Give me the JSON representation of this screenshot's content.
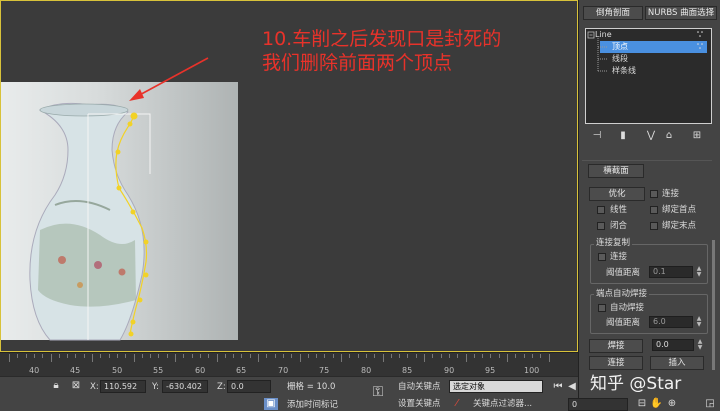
{
  "annotation": {
    "line1": "10.车削之后发现口是封死的",
    "line2": "我们删除前面两个顶点"
  },
  "panel": {
    "lathe_button": "倒角剖面",
    "nurbs_button": "NURBS 曲面选择",
    "stack": {
      "root": "Line",
      "items": [
        "顶点",
        "线段",
        "样条线"
      ]
    },
    "rollout_title": "横截面",
    "optimize_button": "优化",
    "connect_label": "连接",
    "linear_label": "线性",
    "bind_first_label": "绑定首点",
    "closed_label": "闭合",
    "bind_last_label": "绑定末点",
    "connect_copy_group": "连接复制",
    "connect_check_label": "连接",
    "threshold_label": "阈值距离",
    "threshold_value": "0.1",
    "endpoint_weld_group": "端点自动焊接",
    "auto_weld_label": "自动焊接",
    "threshold2_label": "阈值距离",
    "threshold2_value": "6.0",
    "weld_button": "焊接",
    "weld_value": "0.0",
    "connect_button": "连接",
    "insert_button": "插入"
  },
  "timeline": {
    "ticks": [
      "40",
      "45",
      "50",
      "55",
      "60",
      "65",
      "70",
      "75",
      "80",
      "85",
      "90",
      "95",
      "100"
    ]
  },
  "status": {
    "x_label": "X:",
    "x_value": "110.592",
    "y_label": "Y:",
    "y_value": "-630.402",
    "z_label": "Z:",
    "z_value": "0.0",
    "grid_label": "栅格 = 10.0",
    "auto_key_label": "自动关键点",
    "selected_object": "选定对象",
    "set_key_label": "设置关键点",
    "key_filter_label": "关键点过滤器...",
    "add_time_tag": "添加时间标记",
    "frame_value": "0"
  },
  "watermark": "知乎 @Star"
}
